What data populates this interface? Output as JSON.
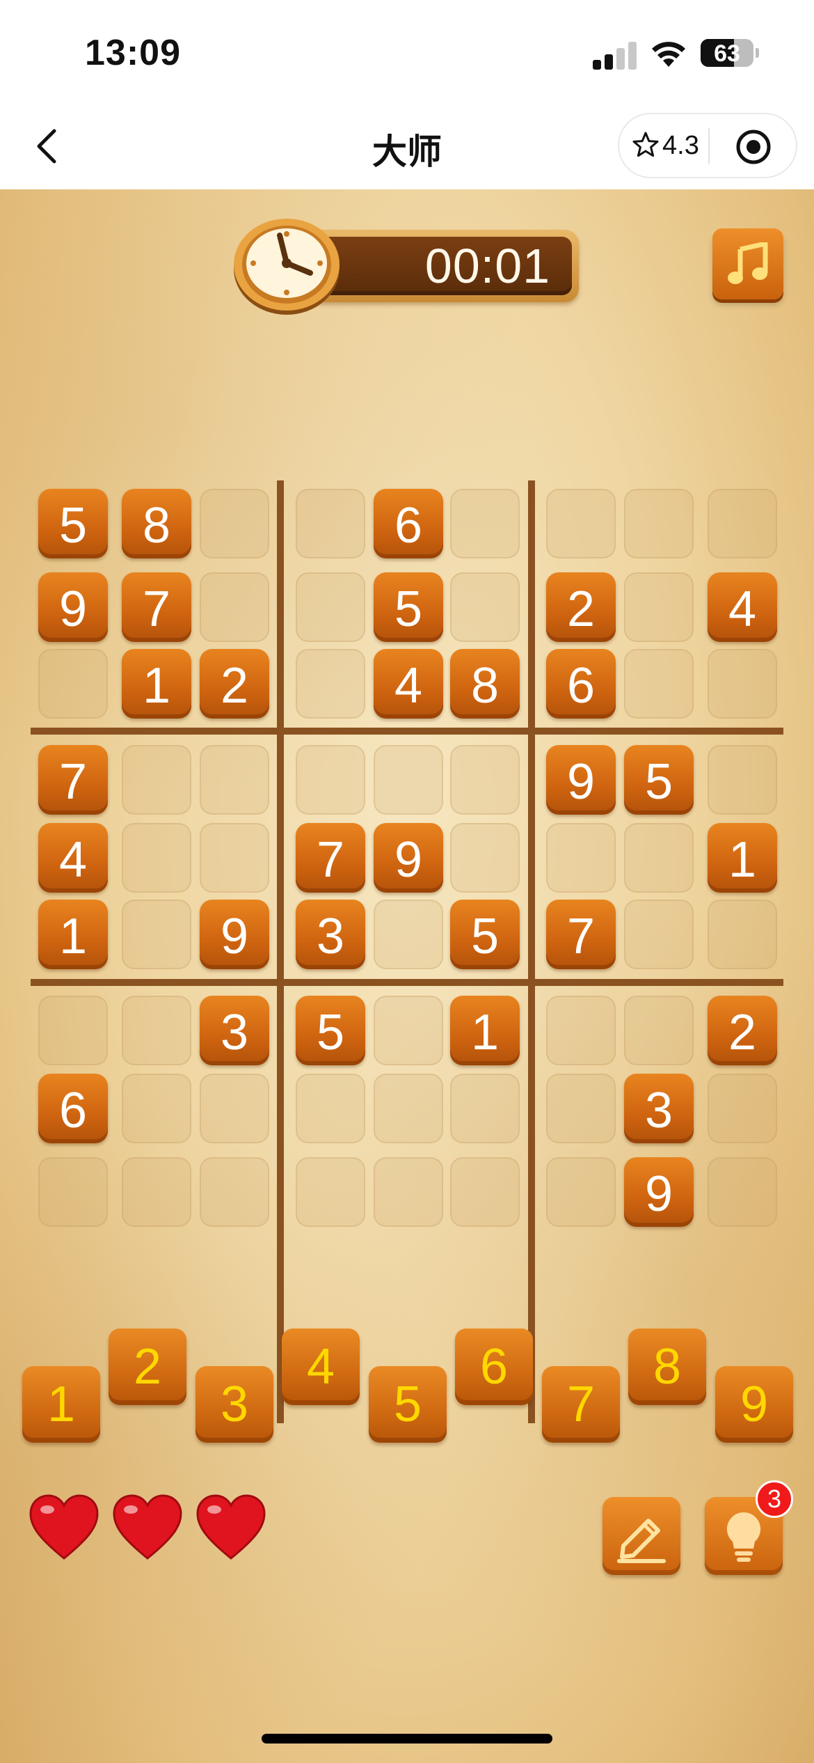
{
  "status_bar": {
    "time": "13:09",
    "battery_level": "63"
  },
  "nav": {
    "title": "大师",
    "rating": "4.3"
  },
  "game": {
    "timer": "00:01",
    "board": [
      [
        5,
        8,
        0,
        0,
        6,
        0,
        0,
        0,
        0
      ],
      [
        9,
        7,
        0,
        0,
        5,
        0,
        2,
        0,
        4
      ],
      [
        0,
        1,
        2,
        0,
        4,
        8,
        6,
        0,
        0
      ],
      [
        7,
        0,
        0,
        0,
        0,
        0,
        9,
        5,
        0
      ],
      [
        4,
        0,
        0,
        7,
        9,
        0,
        0,
        0,
        1
      ],
      [
        1,
        0,
        9,
        3,
        0,
        5,
        7,
        0,
        0
      ],
      [
        0,
        0,
        3,
        5,
        0,
        1,
        0,
        0,
        2
      ],
      [
        6,
        0,
        0,
        0,
        0,
        0,
        0,
        3,
        0
      ],
      [
        0,
        0,
        0,
        0,
        0,
        0,
        0,
        9,
        0
      ]
    ],
    "number_pad": [
      "1",
      "2",
      "3",
      "4",
      "5",
      "6",
      "7",
      "8",
      "9"
    ],
    "lives": 3,
    "hint_count": "3",
    "colors": {
      "tile": "#d06a12",
      "pad_digit": "#ffd800",
      "background": "#efd6a2",
      "heart": "#e0141e",
      "badge": "#f01a1a"
    },
    "icons": {
      "timer": "clock-icon",
      "music": "music-note-icon",
      "erase": "pencil-icon",
      "hint": "lightbulb-icon",
      "life": "heart-icon"
    }
  }
}
